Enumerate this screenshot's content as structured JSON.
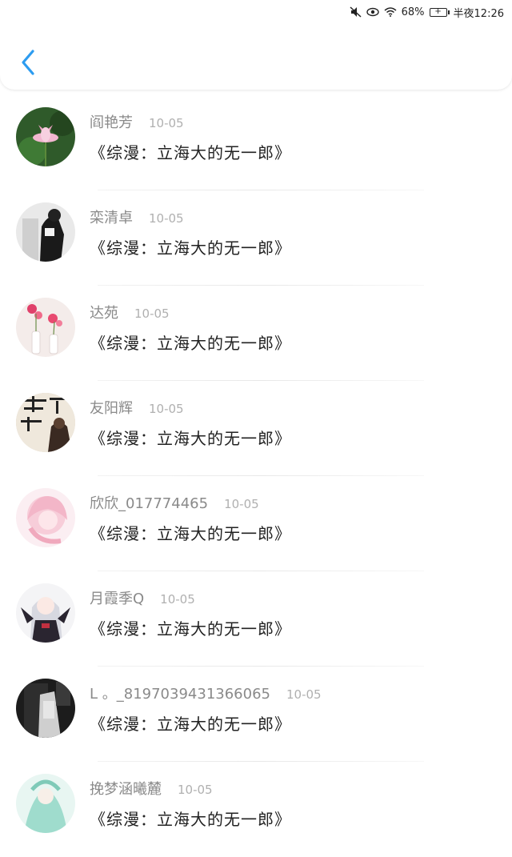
{
  "status_bar": {
    "battery": "68%",
    "time": "半夜12:26"
  },
  "header": {
    "back_icon": "chevron-left-icon",
    "accent": "#2d9cf0"
  },
  "items": [
    {
      "name": "阎艳芳",
      "date": "10-05",
      "title": "《综漫：立海大的无一郎》"
    },
    {
      "name": "栾清卓",
      "date": "10-05",
      "title": "《综漫：立海大的无一郎》"
    },
    {
      "name": "达苑",
      "date": "10-05",
      "title": "《综漫：立海大的无一郎》"
    },
    {
      "name": "友阳辉",
      "date": "10-05",
      "title": "《综漫：立海大的无一郎》"
    },
    {
      "name": "欣欣_017774465",
      "date": "10-05",
      "title": "《综漫：立海大的无一郎》"
    },
    {
      "name": "月霞季Q",
      "date": "10-05",
      "title": "《综漫：立海大的无一郎》"
    },
    {
      "name": "L 。_8197039431366065",
      "date": "10-05",
      "title": "《综漫：立海大的无一郎》"
    },
    {
      "name": "挽梦涵曦麓",
      "date": "10-05",
      "title": "《综漫：立海大的无一郎》"
    }
  ]
}
